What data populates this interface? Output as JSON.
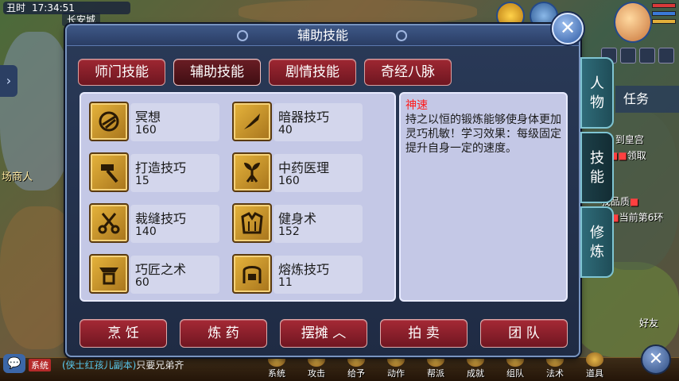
{
  "hud": {
    "shichen": "丑时",
    "time": "17:34:51",
    "city": "长安城",
    "merchant": "场商人",
    "task_tab": "任务",
    "quest_line1_a": "到皇宫",
    "quest_line2_a": "领取",
    "quest_line3_a": "我品质",
    "quest_line4_a": "当前第6环",
    "friend_label": "好友"
  },
  "chat": {
    "channel": "系统",
    "message_prefix": "(侠士红孩儿副本)",
    "message_text": "只要兄弟齐"
  },
  "bottom_menu": [
    "系统",
    "攻击",
    "给予",
    "动作",
    "帮派",
    "成就",
    "组队",
    "法术",
    "道具"
  ],
  "dialog": {
    "title": "辅助技能",
    "tabs": [
      "师门技能",
      "辅助技能",
      "剧情技能",
      "奇经八脉"
    ],
    "active_tab": 1,
    "skills": [
      {
        "name": "冥想",
        "level": "160",
        "icon": "meditation-icon"
      },
      {
        "name": "暗器技巧",
        "level": "40",
        "icon": "dart-icon"
      },
      {
        "name": "打造技巧",
        "level": "15",
        "icon": "hammer-icon"
      },
      {
        "name": "中药医理",
        "level": "160",
        "icon": "herb-icon"
      },
      {
        "name": "裁缝技巧",
        "level": "140",
        "icon": "scissors-icon"
      },
      {
        "name": "健身术",
        "level": "152",
        "icon": "armor-icon"
      },
      {
        "name": "巧匠之术",
        "level": "60",
        "icon": "craft-icon"
      },
      {
        "name": "熔炼技巧",
        "level": "11",
        "icon": "smelt-icon"
      }
    ],
    "description": {
      "title": "神速",
      "body": "持之以恒的锻炼能够使身体更加灵巧机敏！学习效果：每级固定提升自身一定的速度。"
    },
    "bottom_buttons": [
      "烹 饪",
      "炼 药",
      "摆摊",
      "拍 卖",
      "团 队"
    ],
    "side_tabs": [
      {
        "label": "人物"
      },
      {
        "label": "技能"
      },
      {
        "label": "修炼"
      }
    ],
    "active_side_tab": 1
  },
  "colors": {
    "red_button": "#a52935",
    "panel_bg": "#c4c8e6",
    "dialog_bg": "#1f2b44",
    "desc_title": "#ff1a1a",
    "side_tab": "#2f6b78"
  }
}
